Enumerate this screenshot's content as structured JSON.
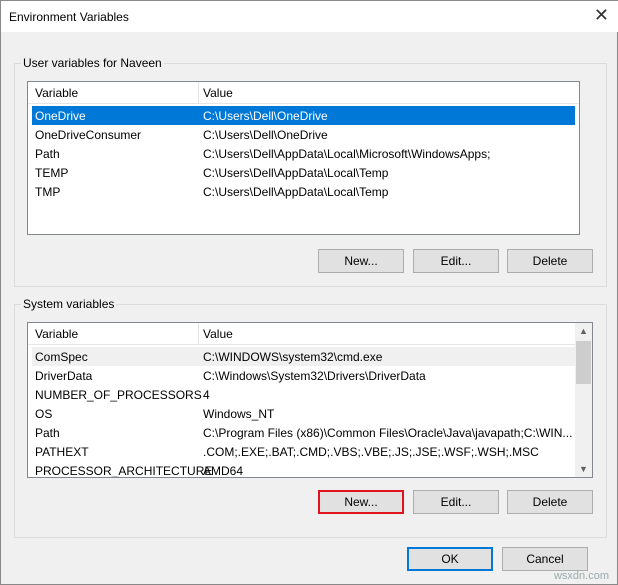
{
  "window": {
    "title": "Environment Variables",
    "close_icon": "close-icon"
  },
  "user": {
    "group_label": "User variables for Naveen",
    "headers": [
      "Variable",
      "Value"
    ],
    "rows": [
      {
        "variable": "OneDrive",
        "value": "C:\\Users\\Dell\\OneDrive",
        "selected": true
      },
      {
        "variable": "OneDriveConsumer",
        "value": "C:\\Users\\Dell\\OneDrive"
      },
      {
        "variable": "Path",
        "value": "C:\\Users\\Dell\\AppData\\Local\\Microsoft\\WindowsApps;"
      },
      {
        "variable": "TEMP",
        "value": "C:\\Users\\Dell\\AppData\\Local\\Temp"
      },
      {
        "variable": "TMP",
        "value": "C:\\Users\\Dell\\AppData\\Local\\Temp"
      }
    ],
    "new": "New...",
    "edit": "Edit...",
    "delete": "Delete"
  },
  "system": {
    "group_label": "System variables",
    "headers": [
      "Variable",
      "Value"
    ],
    "rows": [
      {
        "variable": "ComSpec",
        "value": "C:\\WINDOWS\\system32\\cmd.exe"
      },
      {
        "variable": "DriverData",
        "value": "C:\\Windows\\System32\\Drivers\\DriverData"
      },
      {
        "variable": "NUMBER_OF_PROCESSORS",
        "value": "4"
      },
      {
        "variable": "OS",
        "value": "Windows_NT"
      },
      {
        "variable": "Path",
        "value": "C:\\Program Files (x86)\\Common Files\\Oracle\\Java\\javapath;C:\\WIN..."
      },
      {
        "variable": "PATHEXT",
        "value": ".COM;.EXE;.BAT;.CMD;.VBS;.VBE;.JS;.JSE;.WSF;.WSH;.MSC"
      },
      {
        "variable": "PROCESSOR_ARCHITECTURE",
        "value": "AMD64"
      }
    ],
    "new": "New...",
    "edit": "Edit...",
    "delete": "Delete"
  },
  "footer": {
    "ok": "OK",
    "cancel": "Cancel"
  },
  "watermark": "wsxdn.com",
  "colors": {
    "selection": "#0078d7",
    "highlight_border": "#e0141e"
  }
}
